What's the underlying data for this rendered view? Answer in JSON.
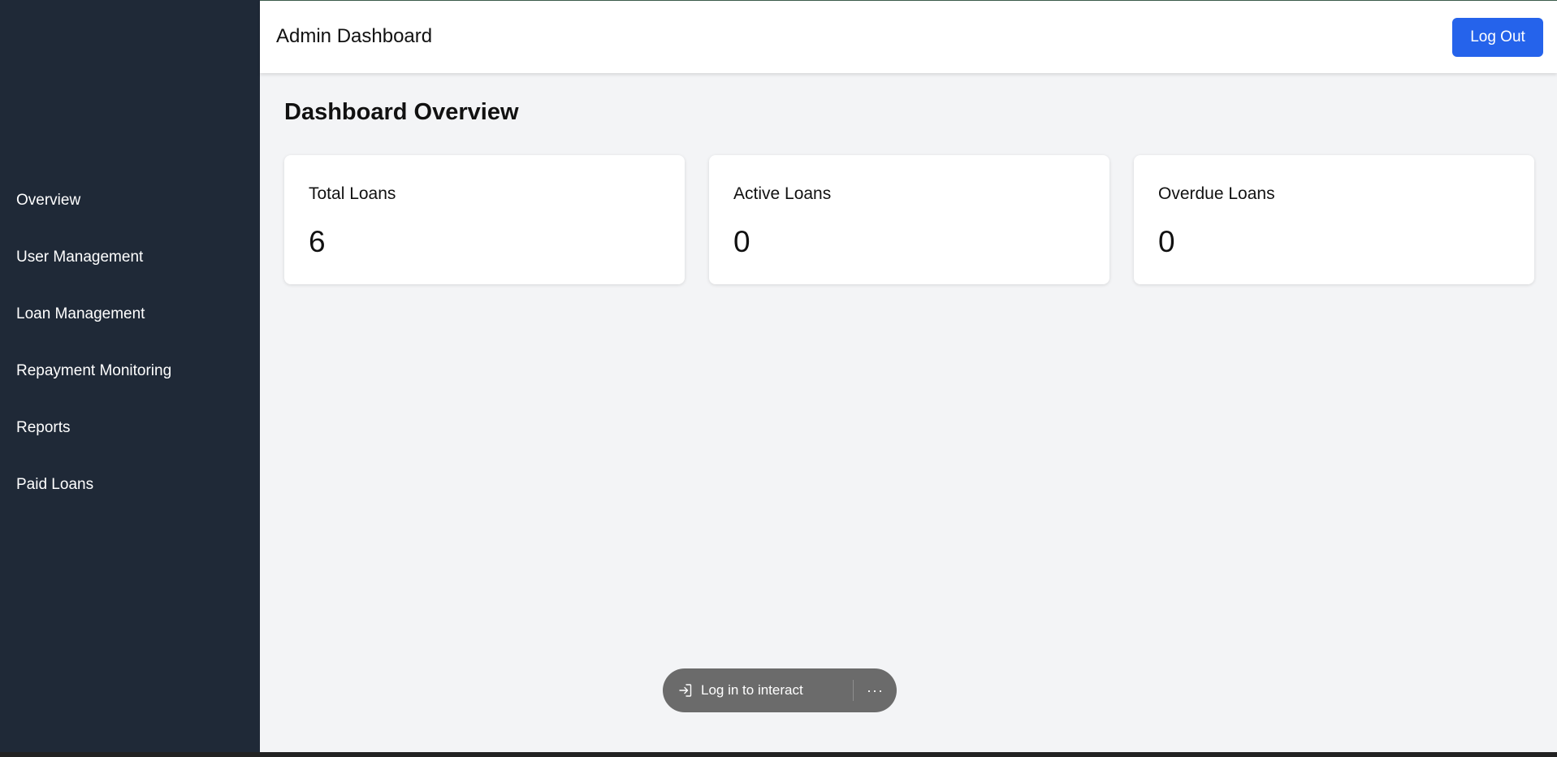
{
  "header": {
    "title": "Admin Dashboard",
    "logout_label": "Log Out"
  },
  "sidebar": {
    "items": [
      {
        "label": "Overview"
      },
      {
        "label": "User Management"
      },
      {
        "label": "Loan Management"
      },
      {
        "label": "Repayment Monitoring"
      },
      {
        "label": "Reports"
      },
      {
        "label": "Paid Loans"
      }
    ]
  },
  "main": {
    "title": "Dashboard Overview",
    "cards": [
      {
        "label": "Total Loans",
        "value": "6"
      },
      {
        "label": "Active Loans",
        "value": "0"
      },
      {
        "label": "Overdue Loans",
        "value": "0"
      }
    ]
  },
  "toast": {
    "login_text": "Log in to interact",
    "login_icon": "login-arrow-icon",
    "more_icon": "more-horizontal-icon",
    "more_glyph": "···"
  },
  "colors": {
    "sidebar_bg": "#1f2937",
    "accent": "#2563eb",
    "page_bg": "#f3f4f6",
    "toast_bg": "#6b6b6b"
  }
}
